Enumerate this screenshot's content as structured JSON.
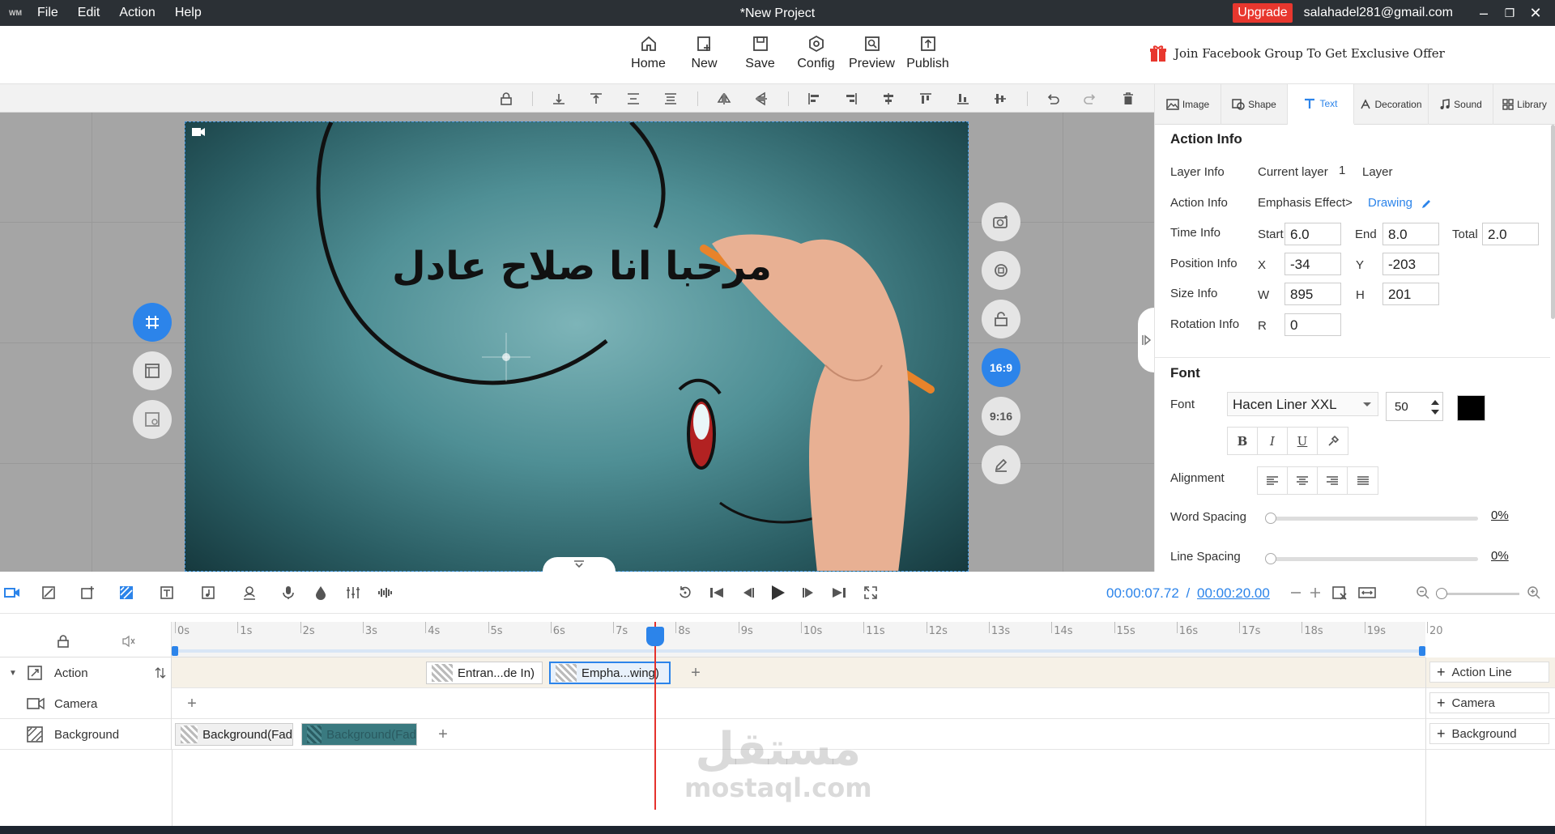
{
  "titlebar": {
    "menu": [
      "File",
      "Edit",
      "Action",
      "Help"
    ],
    "title": "*New Project",
    "upgrade": "Upgrade",
    "email": "salahadel281@gmail.com"
  },
  "main_toolbar": {
    "buttons": [
      "Home",
      "New",
      "Save",
      "Config",
      "Preview",
      "Publish"
    ],
    "promo": "Join Facebook Group To Get Exclusive Offer"
  },
  "canvas": {
    "arabic_text": "مرحبا انا صلاح عادل",
    "side_left": [
      "grid-icon",
      "layout-icon",
      "template-icon"
    ],
    "side_right": [
      "camera-icon",
      "rotate-icon",
      "unlock-icon"
    ],
    "ratio_active": "16:9",
    "ratio_other": "9:16",
    "colors": {
      "accent": "#2c84ea"
    }
  },
  "right_panel": {
    "tabs": [
      "Image",
      "Shape",
      "Text",
      "Decoration",
      "Sound",
      "Library"
    ],
    "active_tab": "Text",
    "action_info": {
      "title": "Action Info",
      "layer_label": "Layer Info",
      "current_layer_label": "Current layer",
      "current_layer_value": "1",
      "layer_text": "Layer",
      "action_label": "Action Info",
      "effect": "Emphasis Effect>",
      "effect_link": "Drawing",
      "time_label": "Time Info",
      "start_label": "Start",
      "start": "6.0",
      "end_label": "End",
      "end": "8.0",
      "total_label": "Total",
      "total": "2.0",
      "position_label": "Position Info",
      "x_label": "X",
      "x": "-34",
      "y_label": "Y",
      "y": "-203",
      "size_label": "Size Info",
      "w_label": "W",
      "w": "895",
      "h_label": "H",
      "h": "201",
      "rotation_label": "Rotation Info",
      "r_label": "R",
      "r": "0"
    },
    "font": {
      "title": "Font",
      "font_label": "Font",
      "font_name": "Hacen Liner XXL",
      "size": "50",
      "color": "#000000",
      "alignment_label": "Alignment",
      "word_spacing_label": "Word Spacing",
      "word_spacing": "0%",
      "line_spacing_label": "Line Spacing",
      "line_spacing": "0%"
    }
  },
  "timeline_toolbar": {
    "current_time": "00:00:07.72",
    "separator": "/",
    "total_time": "00:00:20.00"
  },
  "timeline": {
    "ticks": [
      "0s",
      "1s",
      "2s",
      "3s",
      "4s",
      "5s",
      "6s",
      "7s",
      "8s",
      "9s",
      "10s",
      "11s",
      "12s",
      "13s",
      "14s",
      "15s",
      "16s",
      "17s",
      "18s",
      "19s",
      "20"
    ],
    "rows": {
      "action": "Action",
      "camera": "Camera",
      "background": "Background"
    },
    "clips": {
      "entrance": "Entran...de In)",
      "emphasis": "Empha...wing)",
      "bg1": "Background(Fad",
      "bg2": "Background(Fad"
    },
    "add_lines": {
      "action": "Action Line",
      "camera": "Camera",
      "background": "Background"
    },
    "current_time_seconds": 7.72
  },
  "watermark": {
    "arabic": "مستقل",
    "latin": "mostaql.com"
  }
}
